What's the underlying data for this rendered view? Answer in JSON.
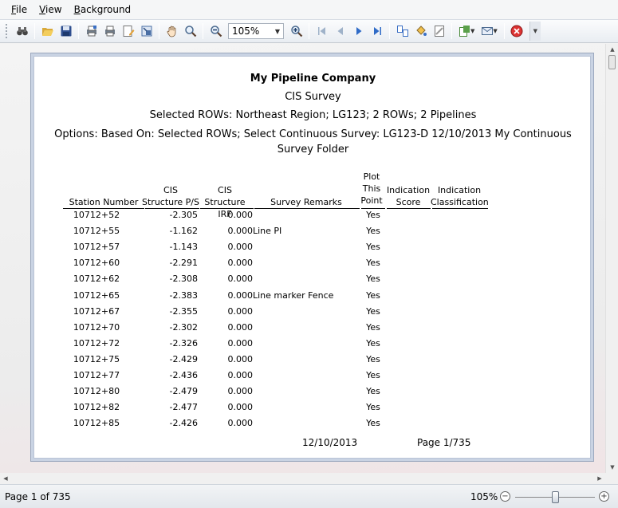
{
  "menu": [
    {
      "accel": "F",
      "rest": "ile"
    },
    {
      "accel": "V",
      "rest": "iew"
    },
    {
      "accel": "B",
      "rest": "ackground"
    }
  ],
  "toolbar": {
    "zoom_value": "105%"
  },
  "report": {
    "company": "My Pipeline Company",
    "title": "CIS Survey",
    "selected_rows": "Selected ROWs: Northeast Region; LG123; 2 ROWs; 2 Pipelines",
    "options": "Options: Based On: Selected ROWs; Select Continuous Survey: LG123-D  12/10/2013  My Continuous Survey Folder",
    "columns": {
      "station": "Station Number",
      "ps": "CIS Structure P/S",
      "irf": "CIS Structure IRF",
      "remarks": "Survey Remarks",
      "plot": "Plot This Point",
      "score": "Indication Score",
      "classification": "Indication Classification"
    },
    "rows": [
      {
        "station": "10712+52",
        "ps": "-2.305",
        "irf": "0.000",
        "remarks": "",
        "plot": "Yes"
      },
      {
        "station": "10712+55",
        "ps": "-1.162",
        "irf": "0.000",
        "remarks": "Line PI",
        "plot": "Yes"
      },
      {
        "station": "10712+57",
        "ps": "-1.143",
        "irf": "0.000",
        "remarks": "",
        "plot": "Yes"
      },
      {
        "station": "10712+60",
        "ps": "-2.291",
        "irf": "0.000",
        "remarks": "",
        "plot": "Yes"
      },
      {
        "station": "10712+62",
        "ps": "-2.308",
        "irf": "0.000",
        "remarks": "",
        "plot": "Yes"
      },
      {
        "station": "10712+65",
        "ps": "-2.383",
        "irf": "0.000",
        "remarks": "Line marker Fence",
        "plot": "Yes"
      },
      {
        "station": "10712+67",
        "ps": "-2.355",
        "irf": "0.000",
        "remarks": "",
        "plot": "Yes"
      },
      {
        "station": "10712+70",
        "ps": "-2.302",
        "irf": "0.000",
        "remarks": "",
        "plot": "Yes"
      },
      {
        "station": "10712+72",
        "ps": "-2.326",
        "irf": "0.000",
        "remarks": "",
        "plot": "Yes"
      },
      {
        "station": "10712+75",
        "ps": "-2.429",
        "irf": "0.000",
        "remarks": "",
        "plot": "Yes"
      },
      {
        "station": "10712+77",
        "ps": "-2.436",
        "irf": "0.000",
        "remarks": "",
        "plot": "Yes"
      },
      {
        "station": "10712+80",
        "ps": "-2.479",
        "irf": "0.000",
        "remarks": "",
        "plot": "Yes"
      },
      {
        "station": "10712+82",
        "ps": "-2.477",
        "irf": "0.000",
        "remarks": "",
        "plot": "Yes"
      },
      {
        "station": "10712+85",
        "ps": "-2.426",
        "irf": "0.000",
        "remarks": "",
        "plot": "Yes"
      }
    ],
    "footer_date": "12/10/2013",
    "footer_page": "Page 1/735"
  },
  "status": {
    "page": "Page 1 of 735",
    "zoom": "105%",
    "zoom_level_percent": 105
  }
}
